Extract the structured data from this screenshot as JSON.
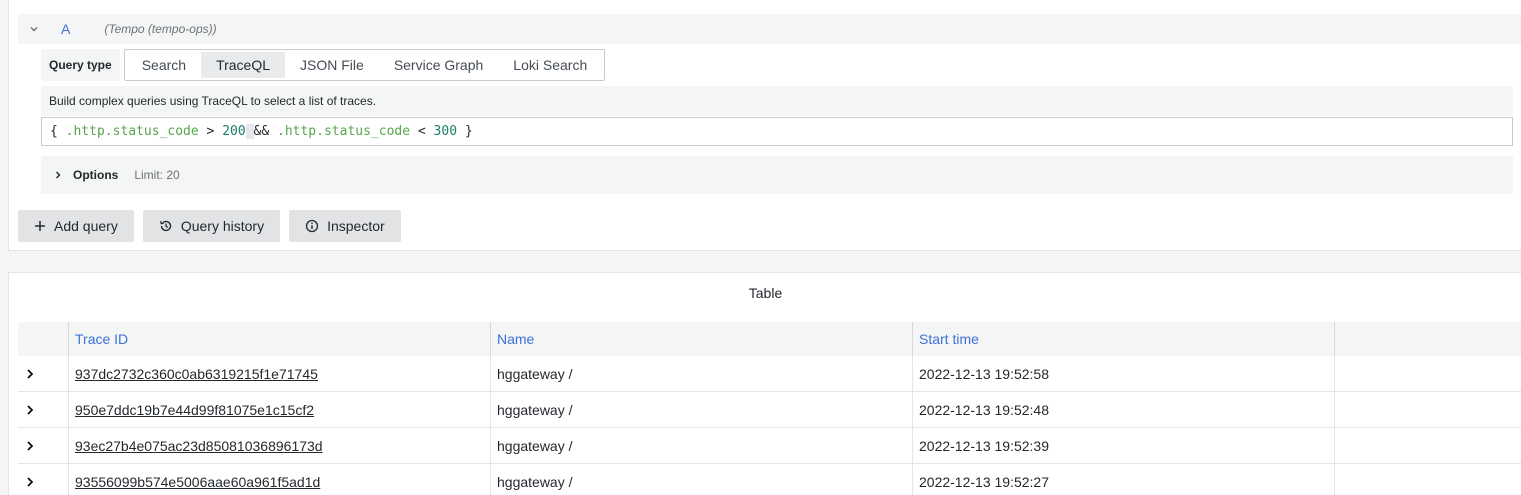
{
  "query": {
    "ref_id": "A",
    "datasource": "(Tempo (tempo-ops))",
    "query_type_label": "Query type",
    "query_types": [
      {
        "label": "Search",
        "active": false
      },
      {
        "label": "TraceQL",
        "active": true
      },
      {
        "label": "JSON File",
        "active": false
      },
      {
        "label": "Service Graph",
        "active": false
      },
      {
        "label": "Loki Search",
        "active": false
      }
    ],
    "help_text": "Build complex queries using TraceQL to select a list of traces.",
    "editor": {
      "tokens": [
        "{ ",
        ".http.status_code",
        " > ",
        "200",
        " ",
        "&&",
        " ",
        ".http.status_code",
        " < ",
        "300",
        " }"
      ]
    },
    "options": {
      "title": "Options",
      "summary": "Limit: 20"
    }
  },
  "buttons": {
    "add_query": "Add query",
    "query_history": "Query history",
    "inspector": "Inspector"
  },
  "table": {
    "title": "Table",
    "columns": [
      "Trace ID",
      "Name",
      "Start time"
    ],
    "rows": [
      {
        "trace_id": "937dc2732c360c0ab6319215f1e71745",
        "name": "hggateway /",
        "start": "2022-12-13 19:52:58"
      },
      {
        "trace_id": "950e7ddc19b7e44d99f81075e1c15cf2",
        "name": "hggateway /",
        "start": "2022-12-13 19:52:48"
      },
      {
        "trace_id": "93ec27b4e075ac23d85081036896173d",
        "name": "hggateway /",
        "start": "2022-12-13 19:52:39"
      },
      {
        "trace_id": "93556099b574e5006aae60a961f5ad1d",
        "name": "hggateway /",
        "start": "2022-12-13 19:52:27"
      }
    ]
  },
  "colors": {
    "accent_blue": "#3d71d9",
    "syntax_attr": "#56a64b",
    "syntax_number": "#1a7f65"
  }
}
